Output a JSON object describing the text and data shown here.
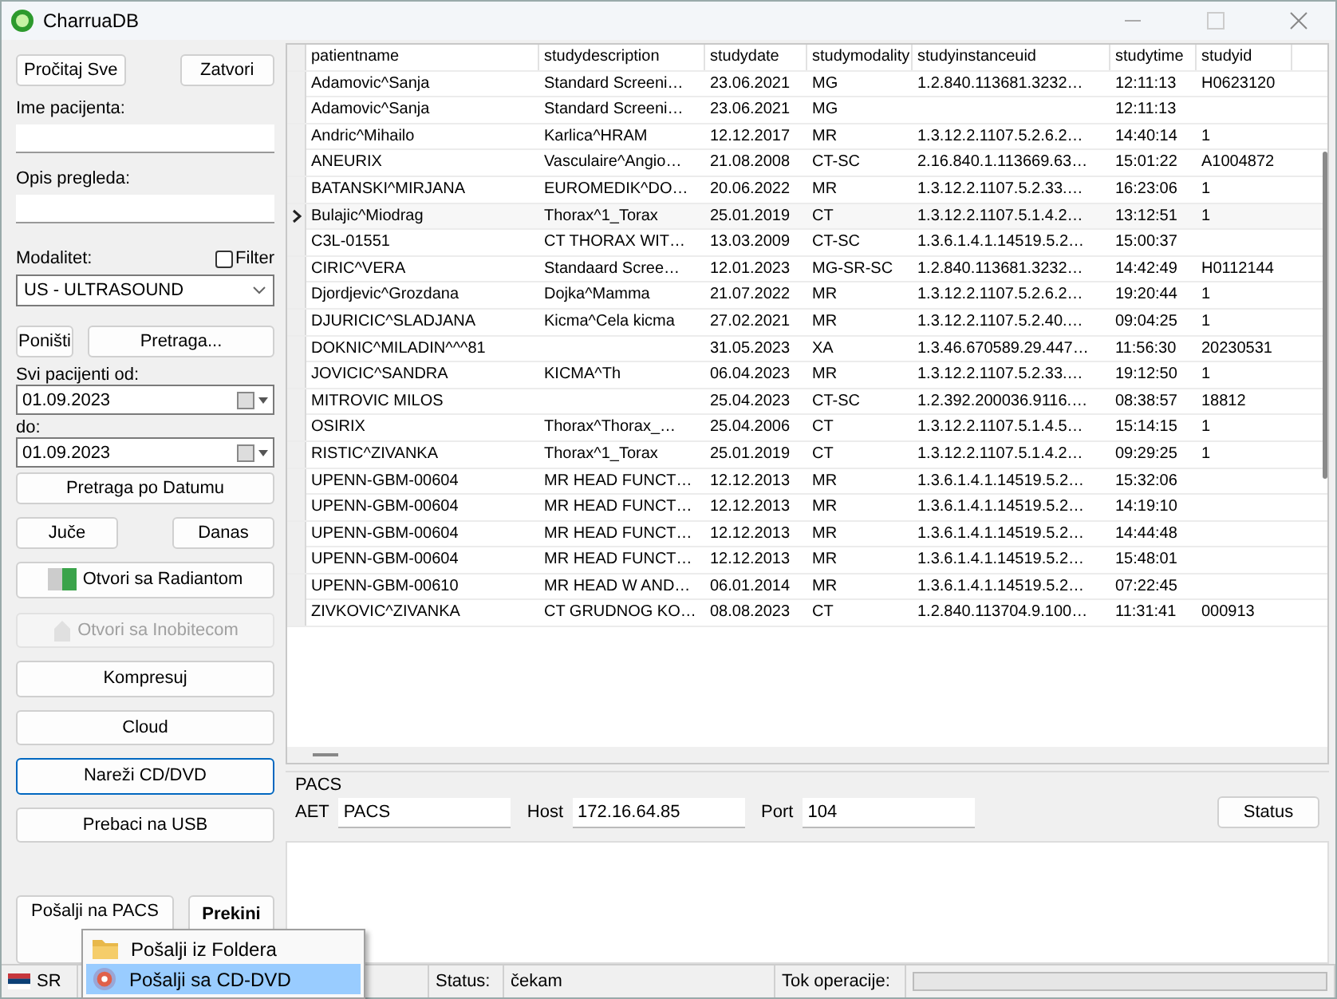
{
  "window": {
    "title": "CharruaDB"
  },
  "left": {
    "top_buttons": [
      {
        "label": "Pročitaj Sve"
      },
      {
        "label": "Zatvori"
      }
    ],
    "patient_label": "Ime pacijenta:",
    "study_label": "Opis pregleda:",
    "modality_label": "Modalitet:",
    "filter": {
      "label": "Filter",
      "checked": false
    },
    "modality": "US - ULTRASOUND",
    "reset_button": "Poništi",
    "search_button": "Pretraga...",
    "from_label": "Svi pacijenti od:",
    "from_date": "01.09.2023",
    "to_label": "do:",
    "to_date": "01.09.2023",
    "date_search_button": "Pretraga po Datumu",
    "day_buttons": [
      {
        "label": "Juče"
      },
      {
        "label": "Danas"
      }
    ],
    "actions": [
      {
        "label": "Otvori sa Radiantom",
        "kind": "radiant",
        "disabled": false,
        "focused": false
      },
      {
        "label": "Otvori sa Inobitecom",
        "kind": "inobitec",
        "disabled": true,
        "focused": false
      },
      {
        "label": "Kompresuj",
        "kind": "plain",
        "disabled": false,
        "focused": false
      },
      {
        "label": "Cloud",
        "kind": "plain",
        "disabled": false,
        "focused": false
      },
      {
        "label": "Nareži CD/DVD",
        "kind": "plain",
        "disabled": false,
        "focused": true
      },
      {
        "label": "Prebaci na USB",
        "kind": "plain",
        "disabled": false,
        "focused": false
      }
    ],
    "send_button": "Pošalji na PACS",
    "stop_button": "Prekini"
  },
  "menu": [
    {
      "label": "Pošalji iz Foldera",
      "kind": "folder",
      "selected": false
    },
    {
      "label": "Pošalji sa CD-DVD",
      "kind": "disc",
      "selected": true
    }
  ],
  "table": {
    "columns": [
      "patientname",
      "studydescription",
      "studydate",
      "studymodality",
      "studyinstanceuid",
      "studytime",
      "studyid"
    ],
    "rows": [
      {
        "selected": false,
        "cells": [
          "Adamovic^Sanja",
          "Standard Screeni…",
          "23.06.2021",
          "MG",
          "1.2.840.113681.3232…",
          "12:11:13",
          "H0623120"
        ]
      },
      {
        "selected": false,
        "cells": [
          "Adamovic^Sanja",
          "Standard Screeni…",
          "23.06.2021",
          "MG",
          "",
          "12:11:13",
          ""
        ]
      },
      {
        "selected": false,
        "cells": [
          "Andric^Mihailo",
          "Karlica^HRAM",
          "12.12.2017",
          "MR",
          "1.3.12.2.1107.5.2.6.2…",
          "14:40:14",
          "1"
        ]
      },
      {
        "selected": false,
        "cells": [
          "ANEURIX",
          "Vasculaire^Angio…",
          "21.08.2008",
          "CT-SC",
          "2.16.840.1.113669.63…",
          "15:01:22",
          "A1004872"
        ]
      },
      {
        "selected": false,
        "cells": [
          "BATANSKI^MIRJANA",
          "EUROMEDIK^DO…",
          "20.06.2022",
          "MR",
          "1.3.12.2.1107.5.2.33.…",
          "16:23:06",
          "1"
        ]
      },
      {
        "selected": true,
        "cells": [
          "Bulajic^Miodrag",
          "Thorax^1_Torax",
          "25.01.2019",
          "CT",
          "1.3.12.2.1107.5.1.4.2…",
          "13:12:51",
          "1"
        ]
      },
      {
        "selected": false,
        "cells": [
          "C3L-01551",
          "CT THORAX  WIT…",
          "13.03.2009",
          "CT-SC",
          "1.3.6.1.4.1.14519.5.2…",
          "15:00:37",
          ""
        ]
      },
      {
        "selected": false,
        "cells": [
          "CIRIC^VERA",
          "Standaard Scree…",
          "12.01.2023",
          "MG-SR-SC",
          "1.2.840.113681.3232…",
          "14:42:49",
          "H0112144"
        ]
      },
      {
        "selected": false,
        "cells": [
          "Djordjevic^Grozdana",
          "Dojka^Mamma",
          "21.07.2022",
          "MR",
          "1.3.12.2.1107.5.2.6.2…",
          "19:20:44",
          "1"
        ]
      },
      {
        "selected": false,
        "cells": [
          "DJURICIC^SLADJANA",
          "Kicma^Cela kicma",
          "27.02.2021",
          "MR",
          "1.3.12.2.1107.5.2.40.…",
          "09:04:25",
          "1"
        ]
      },
      {
        "selected": false,
        "cells": [
          "DOKNIC^MILADIN^^^81",
          "",
          "31.05.2023",
          "XA",
          "1.3.46.670589.29.447…",
          "11:56:30",
          "20230531"
        ]
      },
      {
        "selected": false,
        "cells": [
          "JOVICIC^SANDRA",
          "KICMA^Th",
          "06.04.2023",
          "MR",
          "1.3.12.2.1107.5.2.33.…",
          "19:12:50",
          "1"
        ]
      },
      {
        "selected": false,
        "cells": [
          "MITROVIC MILOS",
          "",
          "25.04.2023",
          "CT-SC",
          "1.2.392.200036.9116.…",
          "08:38:57",
          "18812"
        ]
      },
      {
        "selected": false,
        "cells": [
          "OSIRIX",
          "Thorax^Thorax_…",
          "25.04.2006",
          "CT",
          "1.3.12.2.1107.5.1.4.5…",
          "15:14:15",
          "1"
        ]
      },
      {
        "selected": false,
        "cells": [
          "RISTIC^ZIVANKA",
          "Thorax^1_Torax",
          "25.01.2019",
          "CT",
          "1.3.12.2.1107.5.1.4.2…",
          "09:29:25",
          "1"
        ]
      },
      {
        "selected": false,
        "cells": [
          "UPENN-GBM-00604",
          "MR HEAD FUNCT…",
          "12.12.2013",
          "MR",
          "1.3.6.1.4.1.14519.5.2…",
          "15:32:06",
          ""
        ]
      },
      {
        "selected": false,
        "cells": [
          "UPENN-GBM-00604",
          "MR HEAD FUNCT…",
          "12.12.2013",
          "MR",
          "1.3.6.1.4.1.14519.5.2…",
          "14:19:10",
          ""
        ]
      },
      {
        "selected": false,
        "cells": [
          "UPENN-GBM-00604",
          "MR HEAD FUNCT…",
          "12.12.2013",
          "MR",
          "1.3.6.1.4.1.14519.5.2…",
          "14:44:48",
          ""
        ]
      },
      {
        "selected": false,
        "cells": [
          "UPENN-GBM-00604",
          "MR HEAD FUNCT…",
          "12.12.2013",
          "MR",
          "1.3.6.1.4.1.14519.5.2…",
          "15:48:01",
          ""
        ]
      },
      {
        "selected": false,
        "cells": [
          "UPENN-GBM-00610",
          "MR HEAD W AND…",
          "06.01.2014",
          "MR",
          "1.3.6.1.4.1.14519.5.2…",
          "07:22:45",
          ""
        ]
      },
      {
        "selected": false,
        "cells": [
          "ZIVKOVIC^ZIVANKA",
          "CT GRUDNOG KO…",
          "08.08.2023",
          "CT",
          "1.2.840.113704.9.100…",
          "11:31:41",
          "000913"
        ]
      }
    ]
  },
  "pacs": {
    "title": "PACS",
    "fields": [
      {
        "label": "AET",
        "value": "PACS"
      },
      {
        "label": "Host",
        "value": "172.16.64.85"
      },
      {
        "label": "Port",
        "value": "104"
      }
    ],
    "status_button": "Status"
  },
  "status_bar": {
    "language": "SR",
    "status_label": "Status:",
    "status": "čekam",
    "progress_label": "Tok operacije:",
    "level": 0
  }
}
